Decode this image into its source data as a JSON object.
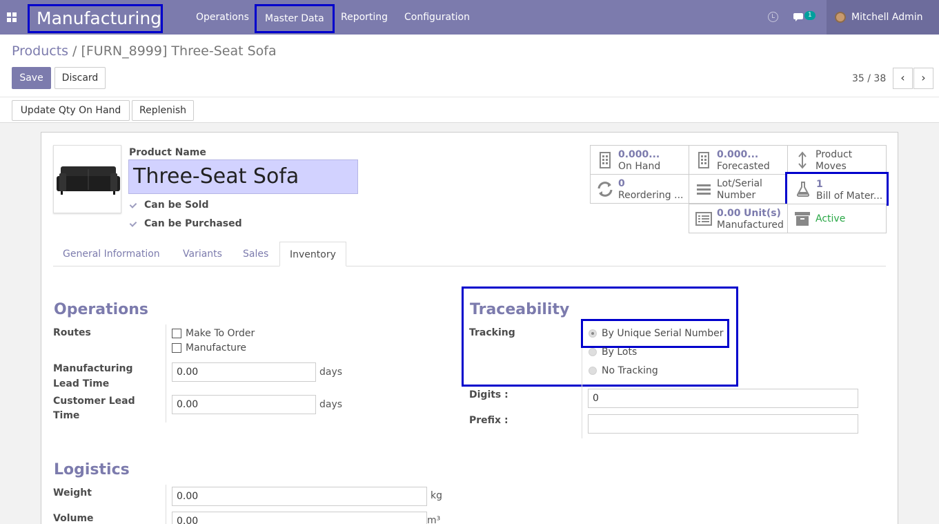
{
  "navbar": {
    "brand": "Manufacturing",
    "menus": [
      "Operations",
      "Master Data",
      "Reporting",
      "Configuration"
    ],
    "chat_badge": "1",
    "user_name": "Mitchell Admin"
  },
  "breadcrumb": {
    "parent": "Products",
    "separator": "/",
    "current": "[FURN_8999] Three-Seat Sofa"
  },
  "actions": {
    "save": "Save",
    "discard": "Discard",
    "update_qty": "Update Qty On Hand",
    "replenish": "Replenish"
  },
  "pager": {
    "value": "35 / 38"
  },
  "product": {
    "name_label": "Product Name",
    "name": "Three-Seat Sofa",
    "can_be_sold": "Can be Sold",
    "can_be_purchased": "Can be Purchased"
  },
  "stats": {
    "on_hand": {
      "value": "0.000...",
      "label": "On Hand"
    },
    "forecasted": {
      "value": "0.000...",
      "label": "Forecasted"
    },
    "product_moves": {
      "line1": "Product",
      "line2": "Moves"
    },
    "reordering": {
      "value": "0",
      "label": "Reordering ..."
    },
    "lot_serial": {
      "line1": "Lot/Serial",
      "line2": "Number"
    },
    "bom": {
      "value": "1",
      "label": "Bill of Mater..."
    },
    "manufactured": {
      "value": "0.00",
      "unit": "Unit(s)",
      "label": "Manufactured"
    },
    "active": "Active"
  },
  "tabs": [
    "General Information",
    "Variants",
    "Sales",
    "Inventory"
  ],
  "operations": {
    "title": "Operations",
    "routes_label": "Routes",
    "route_options": [
      "Make To Order",
      "Manufacture"
    ],
    "mfg_lead_label_1": "Manufacturing",
    "mfg_lead_label_2": "Lead Time",
    "mfg_lead_value": "0.00",
    "cust_lead_label_1": "Customer Lead",
    "cust_lead_label_2": "Time",
    "cust_lead_value": "0.00",
    "days": "days"
  },
  "traceability": {
    "title": "Traceability",
    "tracking_label": "Tracking",
    "options": [
      "By Unique Serial Number",
      "By Lots",
      "No Tracking"
    ],
    "digits_label": "Digits :",
    "digits_value": "0",
    "prefix_label": "Prefix :",
    "prefix_value": ""
  },
  "logistics": {
    "title": "Logistics",
    "weight_label": "Weight",
    "weight_value": "0.00",
    "weight_unit": "kg",
    "volume_label": "Volume",
    "volume_value": "0.00",
    "volume_unit": "m³"
  },
  "colors": {
    "primary": "#7c7bad",
    "highlight": "#0000cc",
    "active_green": "#28a745",
    "badge": "#00a09d"
  }
}
